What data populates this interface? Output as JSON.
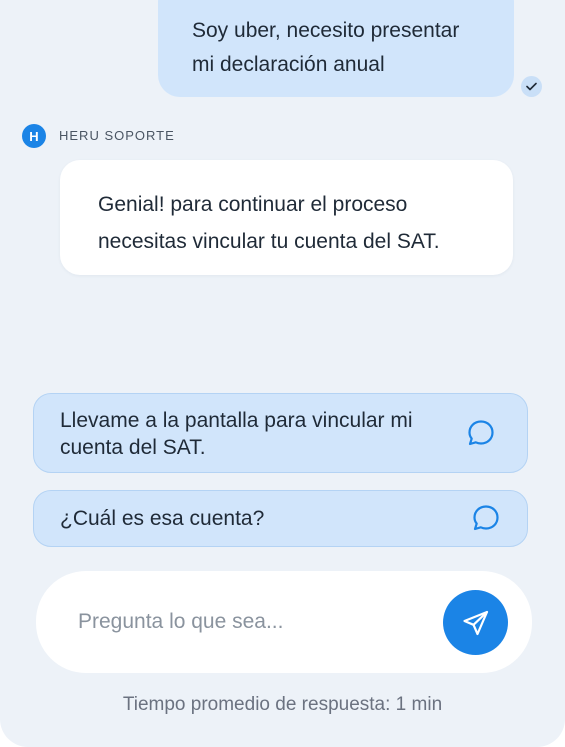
{
  "conversation": {
    "user_message": {
      "line1": "Soy uber, necesito presentar",
      "line2": "mi declaración anual",
      "status_icon": "check-icon"
    },
    "support": {
      "avatar_initial": "H",
      "name": "HERU SOPORTE"
    },
    "bot_message": {
      "line1": "Genial! para continuar el proceso",
      "line2": "necesitas vincular tu cuenta del SAT."
    }
  },
  "suggestions": [
    {
      "line1": "Llevame a la pantalla para vincular mi",
      "line2": "cuenta del SAT.",
      "icon": "chat-bubble-icon"
    },
    {
      "label": "¿Cuál es esa cuenta?",
      "icon": "chat-bubble-icon"
    }
  ],
  "composer": {
    "placeholder": "Pregunta lo que sea...",
    "value": "",
    "send_icon": "send-icon"
  },
  "footer": {
    "response_time": "Tiempo promedio de respuesta: 1 min"
  },
  "colors": {
    "background": "#EDF2F8",
    "user_bubble": "#D1E5FB",
    "accent": "#1B84E6",
    "text": "#1F2A37",
    "muted": "#6B7280"
  }
}
